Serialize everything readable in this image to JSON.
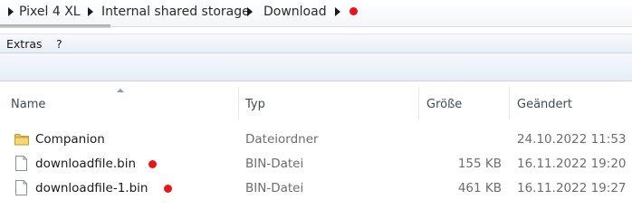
{
  "breadcrumb": {
    "items": [
      "Pixel 4 XL",
      "Internal shared storage",
      "Download"
    ],
    "marker_color": "#e8141a"
  },
  "menu": {
    "items": [
      "Extras",
      "?"
    ]
  },
  "columns": {
    "name": "Name",
    "type": "Typ",
    "size": "Größe",
    "modified": "Geändert",
    "sorted_by": "name",
    "sort_direction": "ascending"
  },
  "files": [
    {
      "name": "Companion",
      "type": "Dateiordner",
      "size": "",
      "modified": "24.10.2022 11:53",
      "icon": "folder-icon",
      "marked": false
    },
    {
      "name": "downloadfile.bin",
      "type": "BIN-Datei",
      "size": "155 KB",
      "modified": "16.11.2022 19:20",
      "icon": "file-icon",
      "marked": true
    },
    {
      "name": "downloadfile-1.bin",
      "type": "BIN-Datei",
      "size": "461 KB",
      "modified": "16.11.2022 19:27",
      "icon": "file-icon",
      "marked": true
    }
  ]
}
